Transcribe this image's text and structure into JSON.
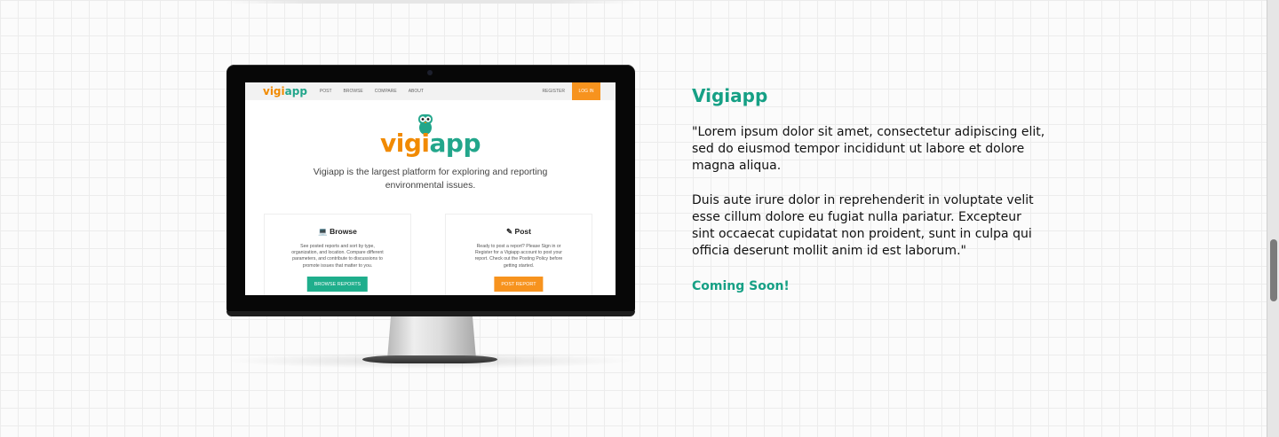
{
  "project": {
    "title": "Vigiapp",
    "paragraph_1": "\"Lorem ipsum dolor sit amet, consectetur adipiscing elit, sed do eiusmod tempor incididunt ut labore et dolore magna aliqua.",
    "paragraph_2": "Duis aute irure dolor in reprehenderit in voluptate velit esse cillum dolore eu fugiat nulla pariatur. Excepteur sint occaecat cupidatat non proident, sunt in culpa qui officia deserunt mollit anim id est laborum.\"",
    "status": "Coming Soon!"
  },
  "mockup": {
    "nav": {
      "logo_a": "vigi",
      "logo_b": "app",
      "links": [
        "POST",
        "BROWSE",
        "COMPARE",
        "ABOUT"
      ],
      "register": "REGISTER",
      "login": "LOG IN"
    },
    "hero": {
      "logo_a": "vigi",
      "logo_b": "app",
      "tagline": "Vigiapp is the largest platform for exploring and reporting environmental issues."
    },
    "cards": [
      {
        "title": "Browse",
        "icon": "laptop-icon",
        "text": "See posted reports and sort by type, organization, and location. Compare different parameters, and contribute to discussions to promote issues that matter to you.",
        "button": "BROWSE REPORTS"
      },
      {
        "title": "Post",
        "icon": "pencil-icon",
        "text": "Ready to post a report? Please Sign in or Register for a Vigiapp account to post your report. Check out the Posting Policy before getting started.",
        "button": "POST REPORT"
      }
    ]
  },
  "colors": {
    "teal": "#16a085",
    "orange": "#f7931e"
  }
}
